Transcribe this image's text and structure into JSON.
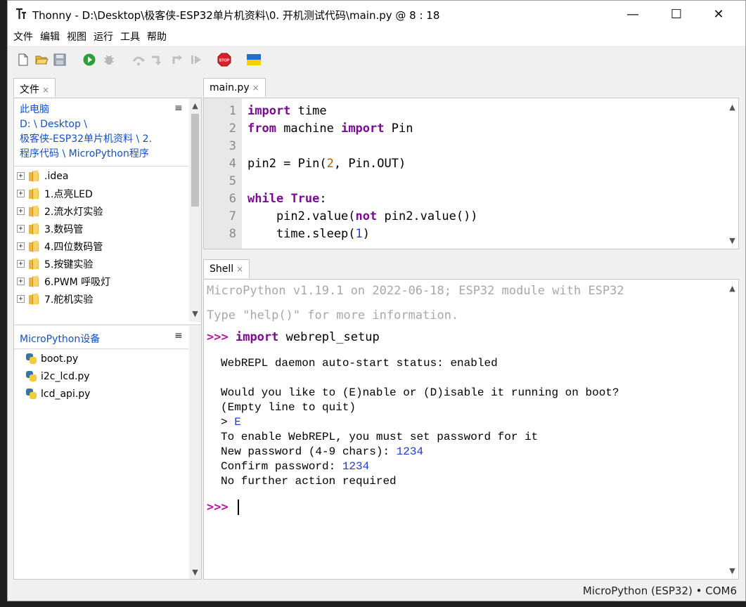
{
  "window": {
    "title": "Thonny  -  D:\\Desktop\\极客侠-ESP32单片机资料\\0. 开机测试代码\\main.py  @  8 : 18",
    "minimize": "—",
    "maximize": "☐",
    "close": "✕"
  },
  "menu": [
    "文件",
    "编辑",
    "视图",
    "运行",
    "工具",
    "帮助"
  ],
  "toolbar": {
    "icons": [
      "new-file-icon",
      "open-folder-icon",
      "save-icon",
      "run-icon",
      "debug-icon",
      "step-over-icon",
      "step-into-icon",
      "step-out-icon",
      "resume-icon",
      "stop-icon",
      "ukraine-flag-icon"
    ],
    "colors": {
      "run": "#2e9e3a",
      "stop": "#d8202a",
      "flag_blue": "#1f6fd0",
      "flag_yellow": "#f5d000"
    }
  },
  "files_panel": {
    "tab_label": "文件",
    "tab_close": "×",
    "menu_glyph": "≡",
    "path_lines": [
      "此电脑",
      "D: \\ Desktop \\",
      "极客侠-ESP32单片机资料 \\ 2.",
      "程序代码 \\ MicroPython程序"
    ],
    "folders": [
      ".idea",
      "1.点亮LED",
      "2.流水灯实验",
      "3.数码管",
      "4.四位数码管",
      "5.按键实验",
      "6.PWM 呼吸灯",
      "7.舵机实验"
    ],
    "expand_glyph": "+",
    "device_title": "MicroPython设备",
    "device_files": [
      "boot.py",
      "i2c_lcd.py",
      "lcd_api.py"
    ]
  },
  "editor": {
    "tab_label": "main.py",
    "tab_close": "×",
    "line_numbers": [
      "1",
      "2",
      "3",
      "4",
      "5",
      "6",
      "7",
      "8"
    ],
    "code": {
      "l1_kw": "import",
      "l1_rest": " time",
      "l2_kw1": "from",
      "l2_mid": " machine ",
      "l2_kw2": "import",
      "l2_rest": " Pin",
      "l4_a": "pin2 = Pin(",
      "l4_num": "2",
      "l4_b": ", Pin.OUT)",
      "l6_kw": "while",
      "l6_sp": " ",
      "l6_kw2": "True",
      "l6_rest": ":",
      "l7_a": "    pin2.value(",
      "l7_kw": "not",
      "l7_b": " pin2.value())",
      "l8_a": "    time.sleep(",
      "l8_num": "1",
      "l8_b": ")"
    }
  },
  "shell": {
    "tab_label": "Shell",
    "tab_close": "×",
    "banner1": "MicroPython v1.19.1 on 2022-06-18; ESP32 module with ESP32",
    "banner2": "Type \"help()\" for more information.",
    "prompt": ">>>",
    "cmd_kw": "import",
    "cmd_rest": " webrepl_setup",
    "out": {
      "l1": "WebREPL daemon auto-start status: enabled",
      "l2": "Would you like to (E)nable or (D)isable it running on boot?",
      "l3": "(Empty line to quit)",
      "l4_a": "> ",
      "l4_b": "E",
      "l5": "To enable WebREPL, you must set password for it",
      "l6_a": "New password (4-9 chars): ",
      "l6_b": "1234",
      "l7_a": "Confirm password: ",
      "l7_b": "1234",
      "l8": "No further action required"
    },
    "prompt2": ">>>"
  },
  "status": {
    "text": "MicroPython (ESP32)  •  COM6"
  }
}
